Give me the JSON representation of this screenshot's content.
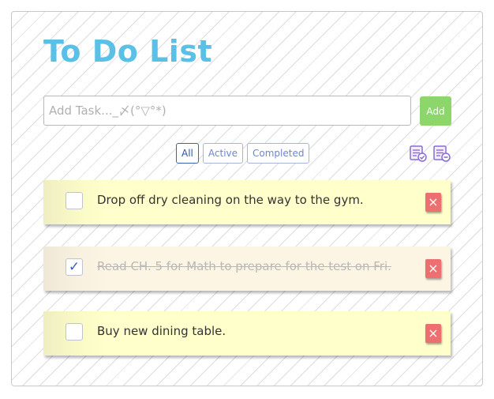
{
  "app": {
    "title": "To Do List"
  },
  "input": {
    "placeholder": "Add Task..._〆(°▽°*)",
    "value": ""
  },
  "add_button": {
    "label": "Add"
  },
  "filters": [
    {
      "label": "All",
      "active": true
    },
    {
      "label": "Active",
      "active": false
    },
    {
      "label": "Completed",
      "active": false
    }
  ],
  "tools": [
    {
      "icon": "complete-all-icon"
    },
    {
      "icon": "clear-completed-icon"
    }
  ],
  "todos": [
    {
      "text": "Drop off dry cleaning on the way to the gym.",
      "completed": false,
      "delete_label": "×"
    },
    {
      "text": "Read CH. 5 for Math to prepare for the test on Fri.",
      "completed": true,
      "check_mark": "✓",
      "delete_label": "×"
    },
    {
      "text": "Buy new dining table.",
      "completed": false,
      "delete_label": "×"
    }
  ],
  "colors": {
    "title": "#5bc0e6",
    "add_button": "#8dd66c",
    "filter_text": "#6f84d6",
    "delete_button": "#ee6f6f",
    "note_active": "#ffffcc",
    "note_completed": "#fcf5e3"
  }
}
